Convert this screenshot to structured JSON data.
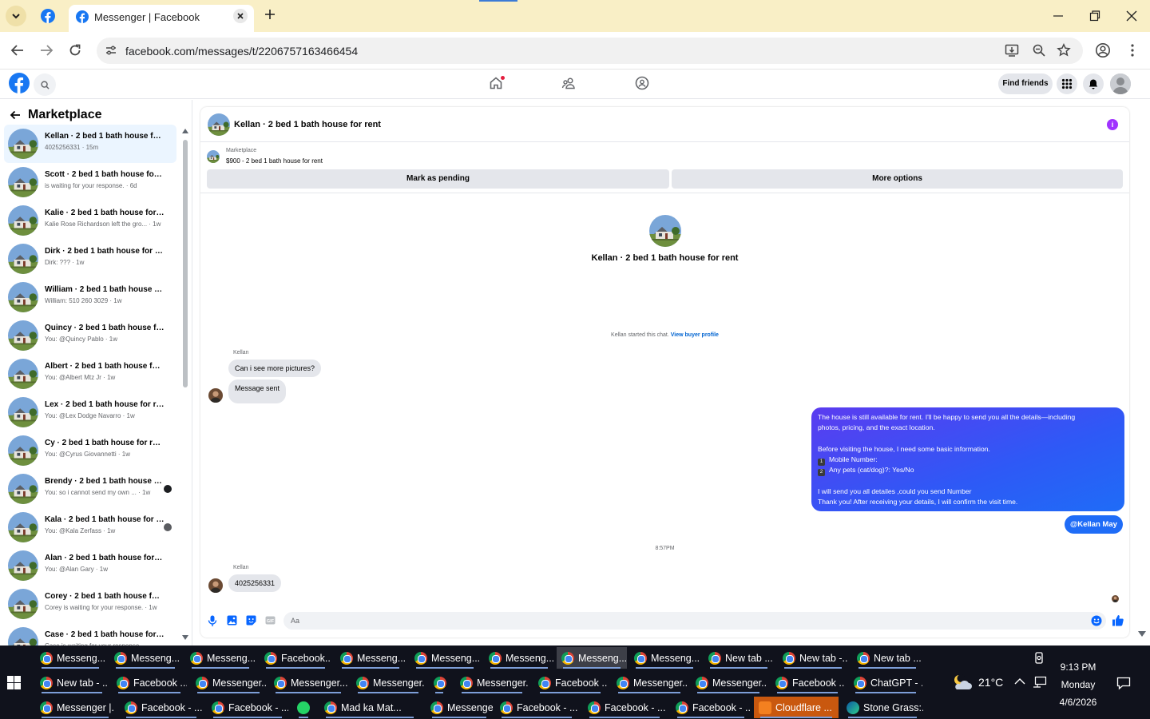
{
  "browser": {
    "active_tab_title": "Messenger | Facebook",
    "url": "facebook.com/messages/t/2206757163466454"
  },
  "fb_header": {
    "find_friends": "Find friends"
  },
  "sidebar": {
    "title": "Marketplace",
    "conversations": [
      {
        "name": "Kellan · 2 bed 1 bath house for rent",
        "preview": "4025256331 · 15m",
        "active": true
      },
      {
        "name": "Scott · 2 bed 1 bath house for rent",
        "preview": "is waiting for your response. · 6d"
      },
      {
        "name": "Kalie · 2 bed 1 bath house for rent",
        "preview": "Kalie Rose Richardson left the gro... · 1w"
      },
      {
        "name": "Dirk · 2 bed 1 bath house for rent",
        "preview": "Dirk: ??? · 1w"
      },
      {
        "name": "William · 2 bed 1 bath house for rent",
        "preview": "William: 510 260 3029 · 1w"
      },
      {
        "name": "Quincy · 2 bed 1 bath house for rent",
        "preview": "You: @Quincy Pablo · 1w"
      },
      {
        "name": "Albert · 2 bed 1 bath house for rent",
        "preview": "You: @Albert Mtz Jr · 1w"
      },
      {
        "name": "Lex · 2 bed 1 bath house for rent",
        "preview": "You: @Lex Dodge Navarro · 1w"
      },
      {
        "name": "Cy · 2 bed 1 bath house for rent",
        "preview": "You: @Cyrus Giovannetti · 1w"
      },
      {
        "name": "Brendy · 2 bed 1 bath house for rent",
        "preview": "You: so i cannot send my own ... · 1w"
      },
      {
        "name": "Kala · 2 bed 1 bath house for rent",
        "preview": "You: @Kala Zerfass · 1w"
      },
      {
        "name": "Alan · 2 bed 1 bath house for rent",
        "preview": "You: @Alan Gary · 1w"
      },
      {
        "name": "Corey · 2 bed 1 bath house for rent",
        "preview": "Corey is waiting for your response. · 1w"
      },
      {
        "name": "Case · 2 bed 1 bath house for rent",
        "preview": "Case is waiting for your response."
      }
    ]
  },
  "chat": {
    "header_title": "Kellan · 2 bed 1 bath house for rent",
    "listing_source": "Marketplace",
    "listing_item": "$900 - 2 bed 1 bath house for rent",
    "mark_pending": "Mark as pending",
    "more_options": "More options",
    "intro_name": "Kellan · 2 bed 1 bath house for rent",
    "started_text": "Kellan started this chat.",
    "view_buyer_profile": "View buyer profile",
    "sender_name": "Kellan",
    "in_msg_1": "Can i see more pictures?",
    "in_msg_2": "Message sent",
    "out_lines": {
      "l1": "The house is still available for rent. I'll be happy to send you all the details—including",
      "l2": "photos, pricing, and the exact location.",
      "l3": "Before visiting the house, I need some basic information.",
      "n1": "1",
      "l4": "Mobile Number:",
      "n2": "2",
      "l5": "Any pets (cat/dog)?: Yes/No",
      "l6": "I will send you all detailes ,could you send Number",
      "l7": "Thank you! After receiving your details, I will confirm the visit time."
    },
    "mention_msg": "@Kellan May",
    "timestamp": "8:57PM",
    "in_msg_3": "4025256331",
    "composer_placeholder": "Aa"
  },
  "taskbar": {
    "row1": [
      "Messeng...",
      "Messeng...",
      "Messeng...",
      "Facebook...",
      "Messeng...",
      "Messeng...",
      "Messeng...",
      "Messeng...",
      "Messeng...",
      "New tab ...",
      "New tab -...",
      "New tab ..."
    ],
    "row2": [
      "New tab - ...",
      "Facebook ...",
      "Messenger...",
      "Messenger...",
      "Messenger...",
      "",
      "Messenger...",
      "Facebook ...",
      "Messenger...",
      "Messenger...",
      "Facebook ...",
      "ChatGPT - ..."
    ],
    "row3": [
      "Messenger |...",
      "Facebook - ...",
      "Facebook - ...",
      "",
      "Mad ka Mat...",
      "Messenger |...",
      "Facebook - ...",
      "Facebook - ...",
      "Facebook - ...",
      "Cloudflare ...",
      "Stone Grass:..."
    ],
    "weather": "21°C",
    "time": "9:13 PM",
    "day": "Monday",
    "date": "4/6/2026"
  }
}
